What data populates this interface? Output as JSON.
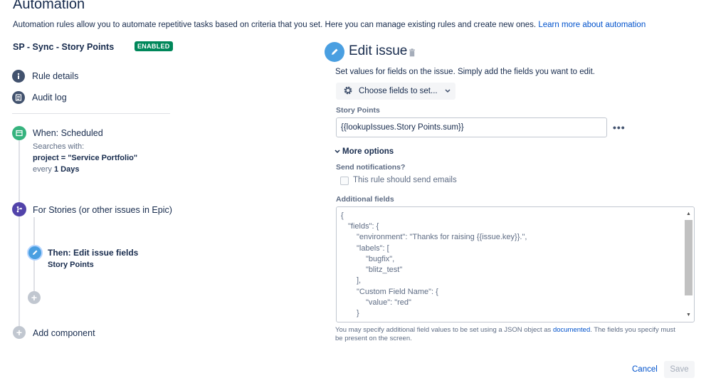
{
  "header": {
    "title": "Automation",
    "description": "Automation rules allow you to automate repetitive tasks based on criteria that you set. Here you can manage existing rules and create new ones.",
    "learn_more": "Learn more about automation"
  },
  "rule": {
    "name": "SP - Sync - Story Points",
    "status_badge": "ENABLED"
  },
  "sidebar": {
    "items": [
      {
        "label": "Rule details",
        "icon": "info-icon"
      },
      {
        "label": "Audit log",
        "icon": "list-icon"
      }
    ]
  },
  "flow": {
    "trigger": {
      "title": "When: Scheduled",
      "line1": "Searches with:",
      "query": "project = \"Service Portfolio\"",
      "every_prefix": "every",
      "every_value": "1 Days"
    },
    "branch": {
      "title": "For Stories (or other issues in Epic)"
    },
    "action": {
      "title": "Then: Edit issue fields",
      "subtitle": "Story Points"
    },
    "add_component": "Add component"
  },
  "editor": {
    "title": "Edit issue",
    "description": "Set values for fields on the issue. Simply add the fields you want to edit.",
    "choose_fields": "Choose fields to set...",
    "story_points_label": "Story Points",
    "story_points_value": "{{lookupIssues.Story Points.sum}}",
    "more_options": "More options",
    "notifications_label": "Send notifications?",
    "send_emails_label": "This rule should send emails",
    "additional_fields_label": "Additional fields",
    "json_lines": [
      "{",
      "\"fields\": {",
      "\"environment\": \"Thanks for raising {{issue.key}}.\",",
      "\"labels\": [",
      "\"bugfix\",",
      "\"blitz_test\"",
      "],",
      "\"Custom Field Name\": {",
      "\"value\": \"red\"",
      "}"
    ],
    "hint_prefix": "You may specify additional field values to be set using a JSON object as",
    "hint_link": "documented",
    "hint_suffix": ". The fields you specify must be present on the screen.",
    "cancel": "Cancel",
    "save": "Save"
  },
  "colors": {
    "enabled_badge": "#00875a",
    "trigger_green": "#36b37e",
    "branch_purple": "#5243aa",
    "action_blue": "#4a9fe1",
    "link_blue": "#0052cc"
  }
}
